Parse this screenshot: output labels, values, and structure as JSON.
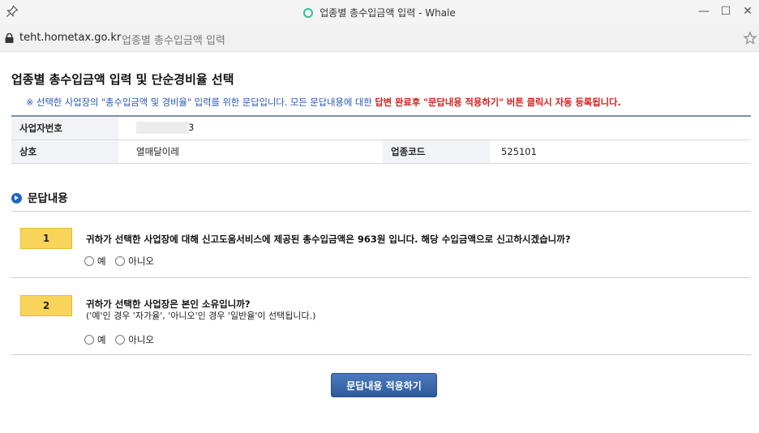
{
  "window": {
    "title": "업종별 총수입금액 입력 - Whale",
    "controls": {
      "minimize": "—",
      "maximize": "☐",
      "close": "✕"
    }
  },
  "address_bar": {
    "domain": "teht.hometax.go.kr",
    "page_title": "업종별 총수입금액 입력"
  },
  "page": {
    "title": "업종별 총수입금액 입력 및 단순경비율 선택",
    "notice_plain": "※ 선택한 사업장의 \"총수입금액 및 경비율\" 입력를 위한 문답입니다. 모든 문답내용에 대한 ",
    "notice_red": "답변 완료후 \"문답내용 적용하기\" 버튼 클릭시 자동 등록됩니다."
  },
  "info_table": {
    "business_number_label": "사업자번호",
    "business_number_value": "3",
    "trade_name_label": "상호",
    "trade_name_value": "열매달이레",
    "industry_code_label": "업종코드",
    "industry_code_value": "525101"
  },
  "qa": {
    "section_title": "문답내용",
    "questions": [
      {
        "number": "1",
        "text": "귀하가 선택한 사업장에 대해 신고도움서비스에 제공된 총수입금액은 963원 입니다. 해당 수입금액으로 신고하시겠습니까?",
        "options": [
          "예",
          "아니오"
        ]
      },
      {
        "number": "2",
        "text": "귀하가 선택한 사업장은 본인 소유입니까?",
        "sub": "('예'인 경우 '자가율', '아니오'인 경우 '일반율'이 선택됩니다.)",
        "options": [
          "예",
          "아니오"
        ]
      }
    ]
  },
  "apply_button": "문답내용 적용하기",
  "colors": {
    "notice_blue": "#2958b5",
    "notice_red": "#d3201b",
    "question_badge": "#f9d45a",
    "button_blue": "#3a68ab",
    "section_bullet": "#1f66c2"
  }
}
